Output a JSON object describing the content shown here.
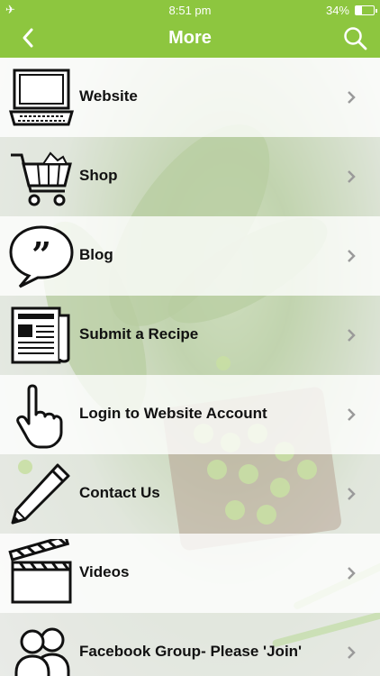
{
  "status_bar": {
    "time": "8:51 pm",
    "battery": "34%"
  },
  "nav": {
    "title": "More"
  },
  "menu": [
    {
      "label": "Website",
      "icon": "laptop-icon"
    },
    {
      "label": "Shop",
      "icon": "shopping-cart-icon"
    },
    {
      "label": "Blog",
      "icon": "speech-bubble-icon"
    },
    {
      "label": "Submit a Recipe",
      "icon": "newspaper-icon"
    },
    {
      "label": "Login to Website Account",
      "icon": "pointing-hand-icon"
    },
    {
      "label": "Contact Us",
      "icon": "pencil-icon"
    },
    {
      "label": "Videos",
      "icon": "clapperboard-icon"
    },
    {
      "label": "Facebook Group- Please 'Join'",
      "icon": "people-icon"
    }
  ],
  "colors": {
    "accent": "#8dc63f",
    "chevron": "#9a9a9a"
  }
}
